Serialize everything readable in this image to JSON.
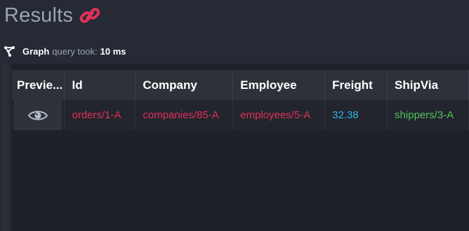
{
  "header": {
    "title": "Results",
    "link_icon": "link-icon",
    "accent_color": "#e0305a"
  },
  "query_info": {
    "icon": "graph-icon",
    "graph_label": "Graph",
    "took_label": "query took:",
    "took_value": "10 ms"
  },
  "grid": {
    "columns": [
      {
        "key": "preview",
        "label": "Previe..."
      },
      {
        "key": "id",
        "label": "Id"
      },
      {
        "key": "company",
        "label": "Company"
      },
      {
        "key": "employee",
        "label": "Employee"
      },
      {
        "key": "freight",
        "label": "Freight"
      },
      {
        "key": "shipvia",
        "label": "ShipVia"
      }
    ],
    "rows": [
      {
        "preview_icon": "eye-icon",
        "id": "orders/1-A",
        "company": "companies/85-A",
        "employee": "employees/5-A",
        "freight": "32.38",
        "shipvia": "shippers/3-A"
      }
    ]
  },
  "colors": {
    "reference": "#e0305a",
    "number": "#2fb0e6",
    "shipper": "#52c35a"
  }
}
